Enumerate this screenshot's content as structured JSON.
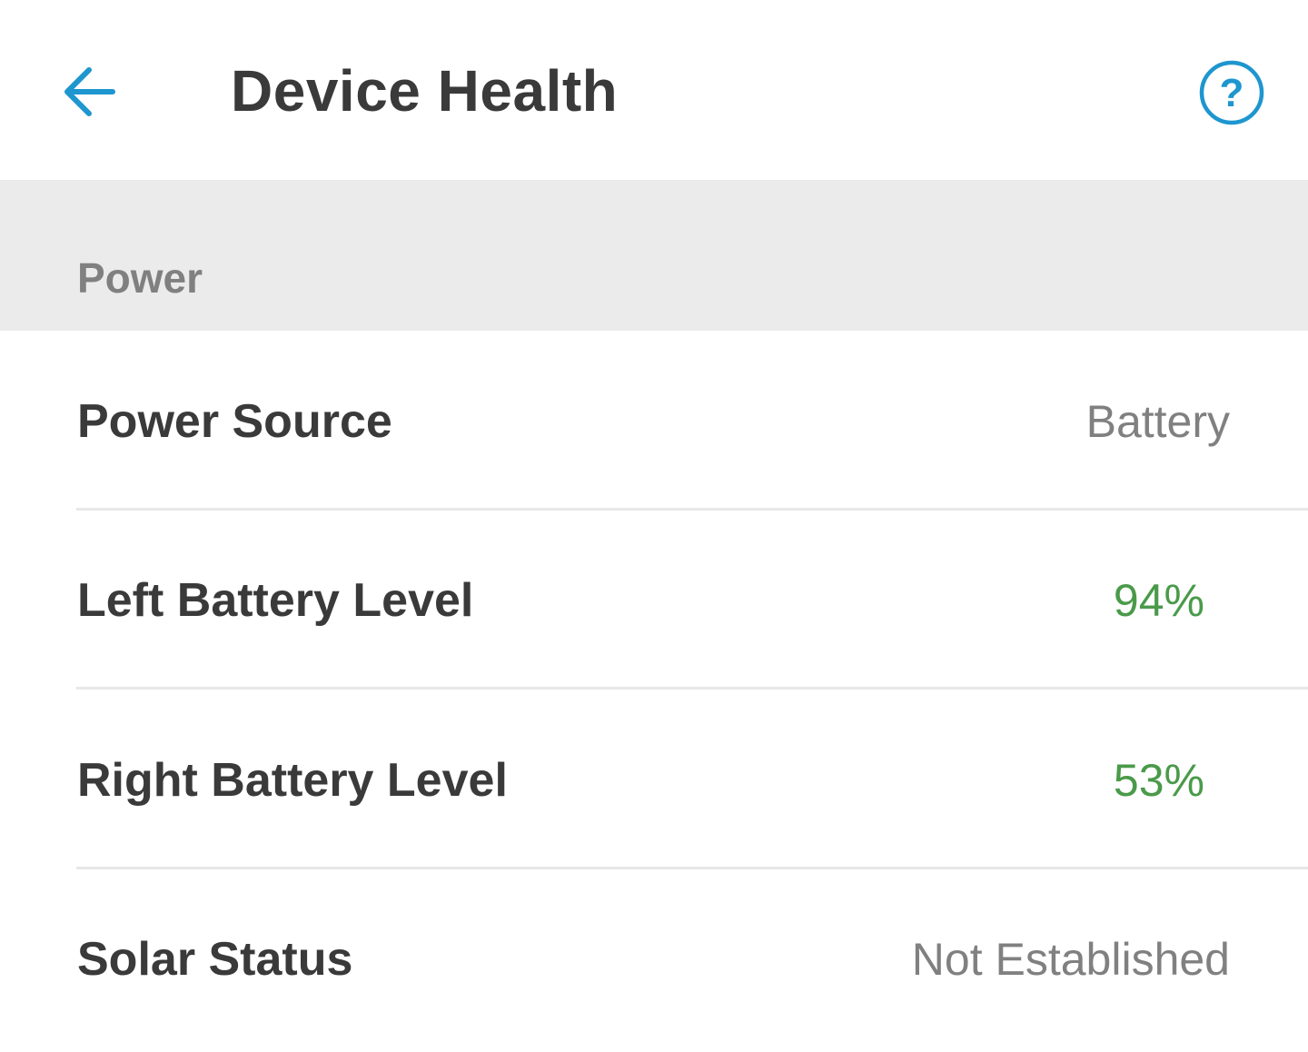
{
  "header": {
    "title": "Device Health",
    "back_icon": "back-arrow-icon",
    "help_icon": "help-circle-icon",
    "accent_color": "#1e96cf"
  },
  "section": {
    "title": "Power"
  },
  "rows": [
    {
      "label": "Power Source",
      "value": "Battery",
      "value_color": "#808080"
    },
    {
      "label": "Left Battery Level",
      "value": "94%",
      "value_color": "#4a9a4a"
    },
    {
      "label": "Right Battery Level",
      "value": "53%",
      "value_color": "#4a9a4a"
    },
    {
      "label": "Solar Status",
      "value": "Not Established",
      "value_color": "#808080"
    }
  ]
}
